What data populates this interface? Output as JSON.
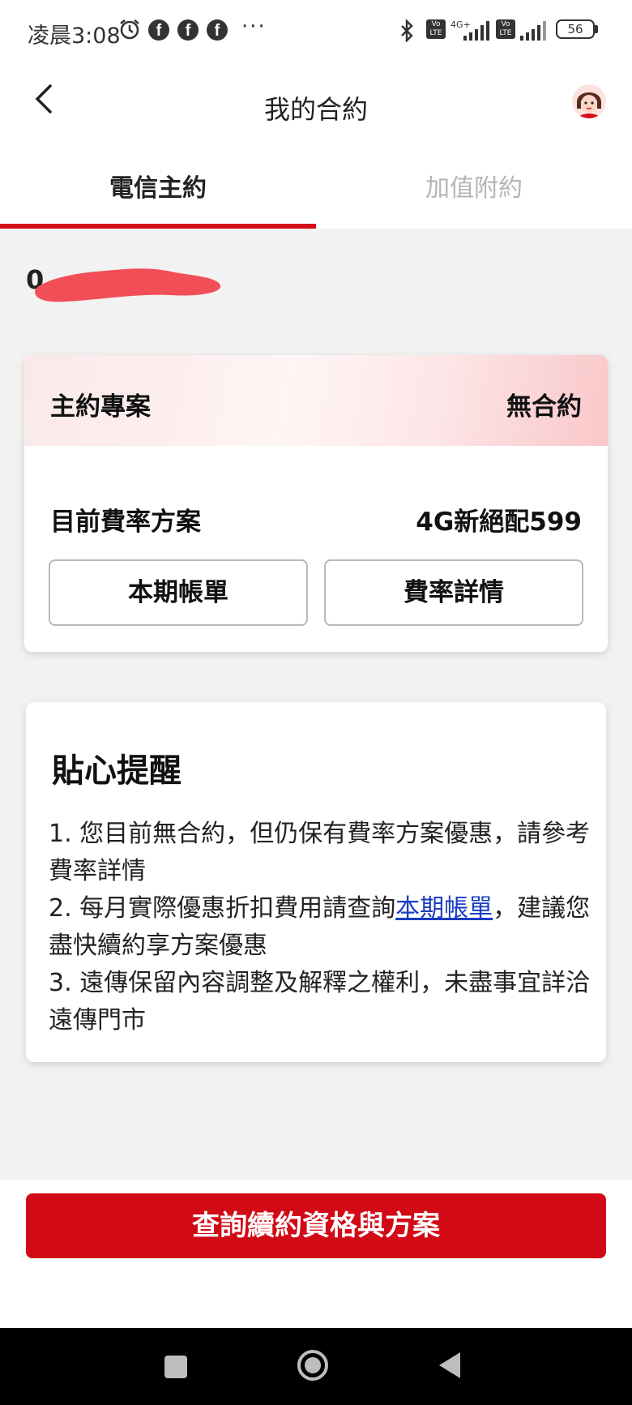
{
  "status_bar": {
    "time": "凌晨3:08",
    "network": "4G+",
    "battery": "56"
  },
  "header": {
    "title": "我的合約"
  },
  "tabs": [
    {
      "label": "電信主約",
      "active": true
    },
    {
      "label": "加值附約",
      "active": false
    }
  ],
  "phone_number": "0",
  "contract": {
    "header_label": "主約專案",
    "header_value": "無合約",
    "plan_label": "目前費率方案",
    "plan_value": "4G新絕配599",
    "bill_button": "本期帳單",
    "rate_button": "費率詳情"
  },
  "reminder": {
    "title": "貼心提醒",
    "item1": "1. 您目前無合約，但仍保有費率方案優惠，請參考費率詳情",
    "item2_prefix": "2. 每月實際優惠折扣費用請查詢",
    "item2_link": "本期帳單",
    "item2_suffix": "，建議您盡快續約享方案優惠",
    "item3": "3. 遠傳保留內容調整及解釋之權利，未盡事宜詳洽遠傳門市"
  },
  "cta": {
    "label": "查詢續約資格與方案"
  },
  "colors": {
    "accent": "#d10a16",
    "link": "#1a3ec2"
  }
}
